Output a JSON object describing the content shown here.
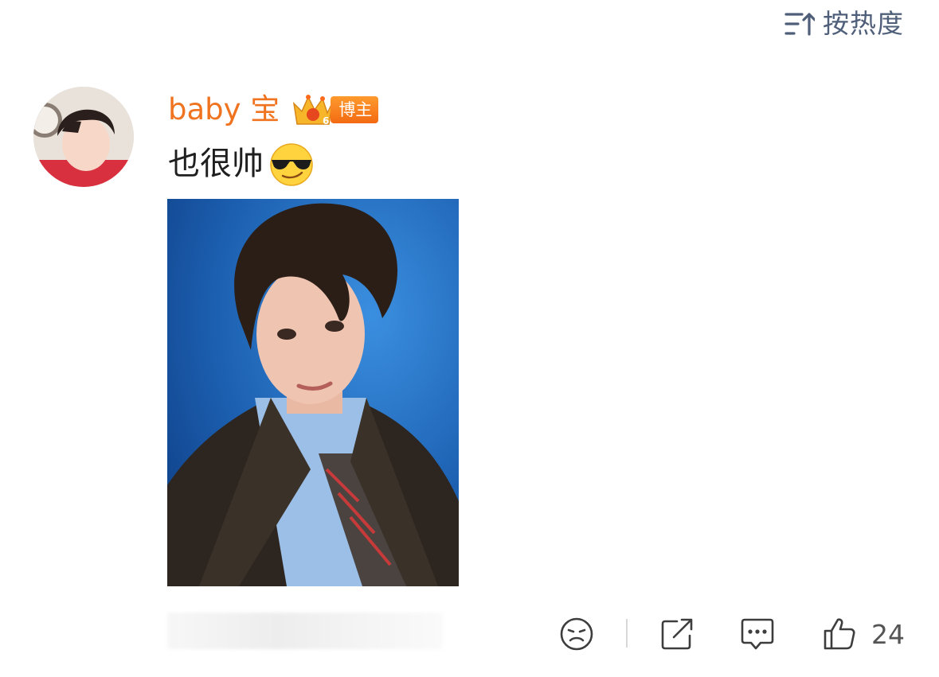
{
  "sort": {
    "label": "按热度",
    "icon": "sort-lines-up-icon"
  },
  "comment": {
    "username": "baby 宝",
    "badge_label": "博主",
    "badge_icon": "crown-badge-icon",
    "text": "也很帅",
    "emoji": "cool-sunglasses-emoji"
  },
  "actions": {
    "react_icon": "neutral-face-icon",
    "share_icon": "share-icon",
    "reply_icon": "comment-bubble-icon",
    "like_icon": "thumbs-up-icon",
    "like_count": "24"
  },
  "colors": {
    "username": "#f0731f",
    "sort": "#4f5f7a",
    "badge": "#f36a12",
    "icons": "#3d3d3d"
  }
}
